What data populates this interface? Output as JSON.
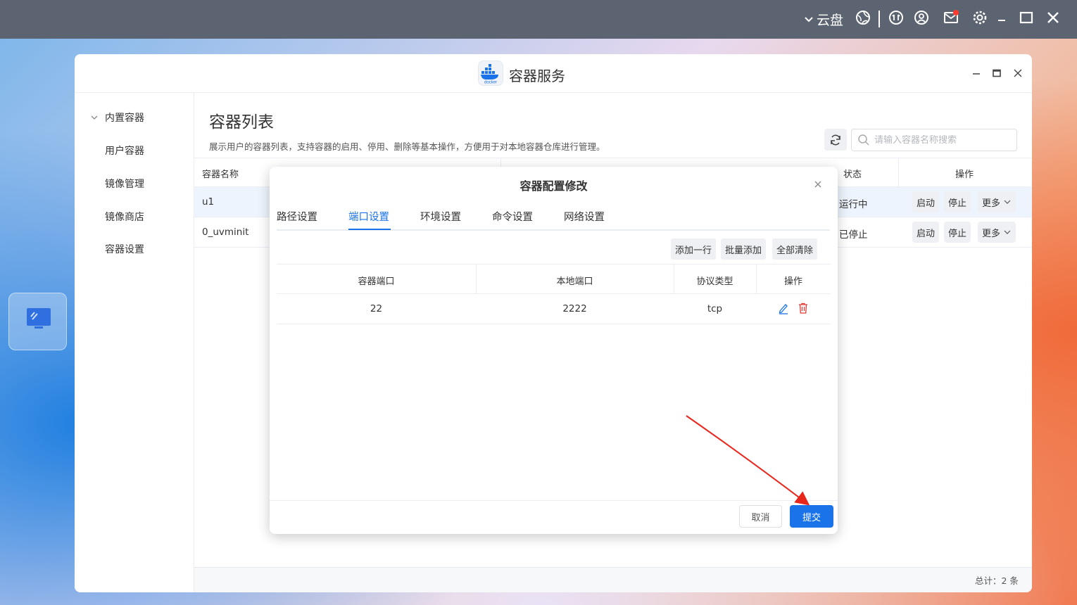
{
  "system_bar": {
    "cloud_label": "云盘",
    "icons": [
      "chevron-down-icon",
      "globe-icon",
      "upload-icon",
      "user-icon",
      "mail-icon",
      "settings-icon",
      "minimize-icon",
      "maximize-icon",
      "close-icon"
    ]
  },
  "window": {
    "title": "容器服务",
    "logo_text": "docker"
  },
  "sidebar": {
    "group_label": "内置容器",
    "items": [
      {
        "label": "用户容器"
      },
      {
        "label": "镜像管理"
      },
      {
        "label": "镜像商店"
      },
      {
        "label": "容器设置"
      }
    ]
  },
  "main": {
    "title": "容器列表",
    "description": "展示用户的容器列表，支持容器的启用、停用、删除等基本操作，方便用于对本地容器仓库进行管理。",
    "search_placeholder": "请输入容器名称搜索",
    "columns": {
      "name": "容器名称",
      "status": "状态",
      "actions": "操作"
    },
    "rows": [
      {
        "name": "u1",
        "status": "运行中",
        "start": "启动",
        "stop": "停止",
        "more": "更多"
      },
      {
        "name": "0_uvminit",
        "status": "已停止",
        "start": "启动",
        "stop": "停止",
        "more": "更多"
      }
    ],
    "total": "总计：2 条"
  },
  "modal": {
    "title": "容器配置修改",
    "tabs": [
      {
        "label": "路径设置"
      },
      {
        "label": "端口设置",
        "active": true
      },
      {
        "label": "环境设置"
      },
      {
        "label": "命令设置"
      },
      {
        "label": "网络设置"
      }
    ],
    "toolbar": {
      "add_row": "添加一行",
      "batch_add": "批量添加",
      "clear_all": "全部清除"
    },
    "columns": {
      "container_port": "容器端口",
      "local_port": "本地端口",
      "protocol": "协议类型",
      "actions": "操作"
    },
    "rows": [
      {
        "container_port": "22",
        "local_port": "2222",
        "protocol": "tcp"
      }
    ],
    "cancel_label": "取消",
    "submit_label": "提交"
  },
  "colors": {
    "accent": "#1a73e8",
    "danger": "#e53935",
    "annotation_arrow": "#e8261c"
  }
}
